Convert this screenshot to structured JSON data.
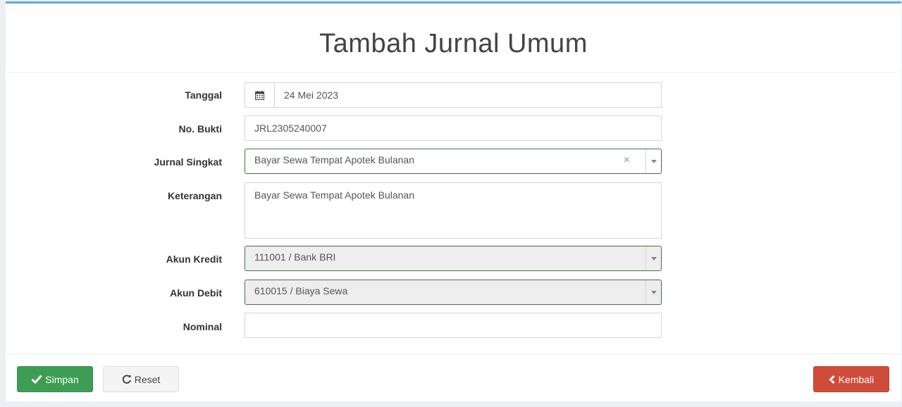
{
  "page": {
    "title": "Tambah Jurnal Umum"
  },
  "form": {
    "tanggal": {
      "label": "Tanggal",
      "value": "24 Mei 2023",
      "icon": "calendar-icon"
    },
    "no_bukti": {
      "label": "No. Bukti",
      "value": "JRL2305240007"
    },
    "jurnal_singkat": {
      "label": "Jurnal Singkat",
      "value": "Bayar Sewa Tempat Apotek Bulanan",
      "clear": "×"
    },
    "keterangan": {
      "label": "Keterangan",
      "value": "Bayar Sewa Tempat Apotek Bulanan"
    },
    "akun_kredit": {
      "label": "Akun Kredit",
      "value": "111001 / Bank BRI"
    },
    "akun_debit": {
      "label": "Akun Debit",
      "value": "610015 / Biaya Sewa"
    },
    "nominal": {
      "label": "Nominal",
      "value": ""
    }
  },
  "buttons": {
    "simpan": {
      "label": "Simpan",
      "icon": "check-icon"
    },
    "reset": {
      "label": "Reset",
      "icon": "refresh-icon"
    },
    "kembali": {
      "label": "Kembali",
      "icon": "chevron-left-icon"
    }
  },
  "colors": {
    "accent_top": "#5dade2",
    "success": "#3e9d54",
    "danger": "#cf4b3a",
    "valid_border": "#3c763d"
  }
}
